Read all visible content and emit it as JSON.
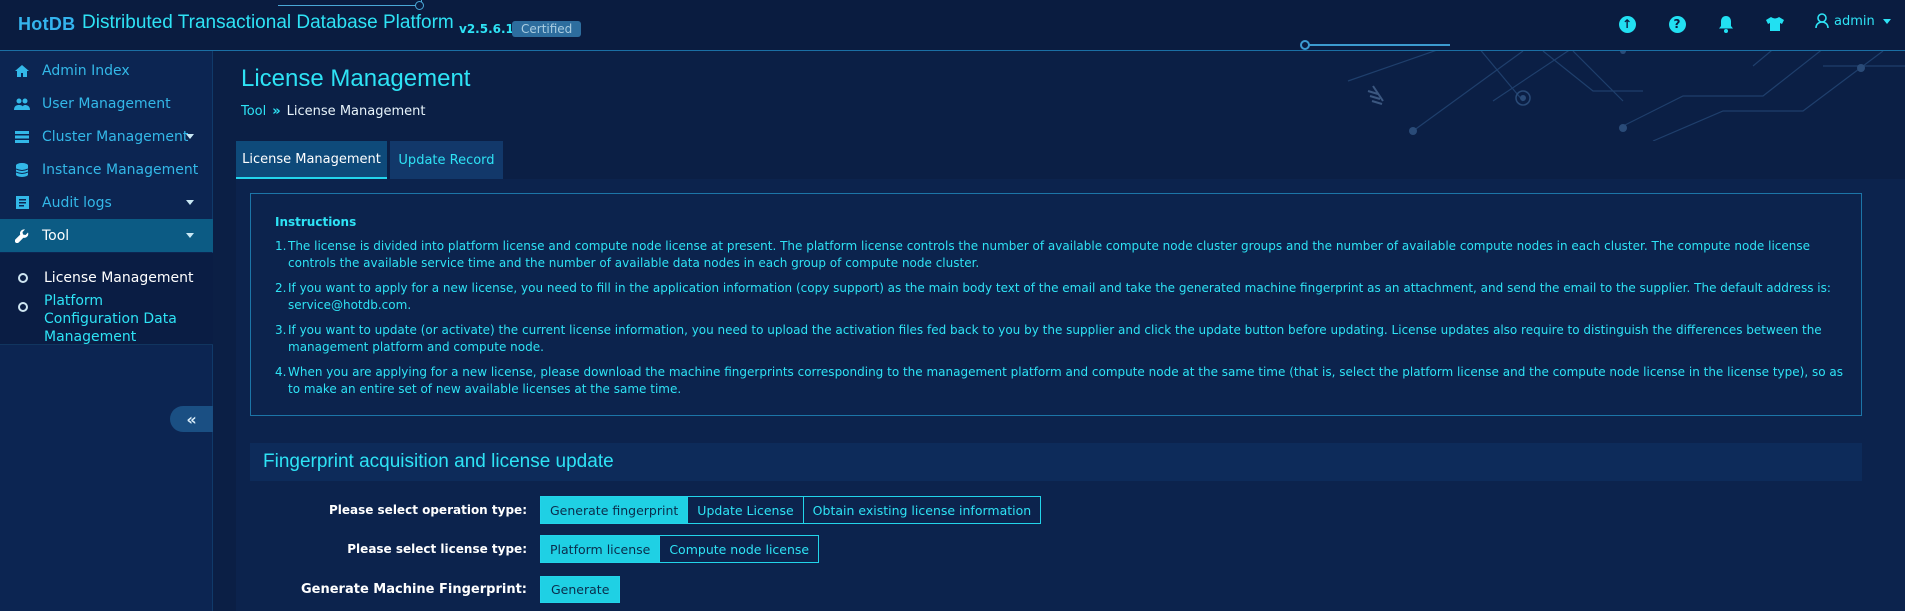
{
  "app": {
    "logo": "HotDB",
    "title": "Distributed Transactional Database Platform",
    "version": "v2.5.6.1",
    "badge": "Certified"
  },
  "header": {
    "icons": [
      "upload-icon",
      "help-icon",
      "bell-icon",
      "shirt-icon"
    ],
    "user": "admin"
  },
  "sidebar": {
    "items": [
      {
        "label": "Admin Index",
        "icon": "home-icon"
      },
      {
        "label": "User Management",
        "icon": "users-icon"
      },
      {
        "label": "Cluster Management",
        "icon": "cluster-icon"
      },
      {
        "label": "Instance Management",
        "icon": "database-icon"
      },
      {
        "label": "Audit logs",
        "icon": "log-icon"
      },
      {
        "label": "Tool",
        "icon": "wrench-icon"
      }
    ],
    "subitems": [
      {
        "label": "License Management"
      },
      {
        "label": "Platform Configuration Data Management"
      }
    ],
    "collapse": "«"
  },
  "page": {
    "title": "License Management",
    "breadcrumb": {
      "root": "Tool",
      "sep": "»",
      "current": "License Management"
    }
  },
  "tabs": [
    {
      "label": "License Management"
    },
    {
      "label": "Update Record"
    }
  ],
  "instructions": {
    "title": "Instructions",
    "items": [
      "The license is divided into platform license and compute node license at present. The platform license controls the number of available compute node cluster groups and the number of available compute nodes in each cluster. The compute node license controls the available service time and the number of available data nodes in each group of compute node cluster.",
      "If you want to apply for a new license, you need to fill in the application information (copy support) as the main body text of the email and take the generated machine fingerprint as an attachment, and send the email to the supplier. The default address is: service@hotdb.com.",
      "If you want to update (or activate) the current license information, you need to upload the activation files fed back to you by the supplier and click the update button before updating. License updates also require to distinguish the differences between the management platform and compute node.",
      "When you are applying for a new license, please download the machine fingerprints corresponding to the management platform and compute node at the same time (that is, select the platform license and the compute node license in the license type), so as to make an entire set of new available licenses at the same time."
    ]
  },
  "fingerprint": {
    "title": "Fingerprint acquisition and license update",
    "op_label": "Please select operation type:",
    "op_options": [
      "Generate fingerprint",
      "Update License",
      "Obtain existing license information"
    ],
    "type_label": "Please select license type:",
    "type_options": [
      "Platform license",
      "Compute node license"
    ],
    "gen_label": "Generate Machine Fingerprint:",
    "gen_button": "Generate"
  },
  "colors": {
    "accent": "#2ee3f5",
    "background": "#0b1f45",
    "sidebar_active": "#0c5b84"
  }
}
